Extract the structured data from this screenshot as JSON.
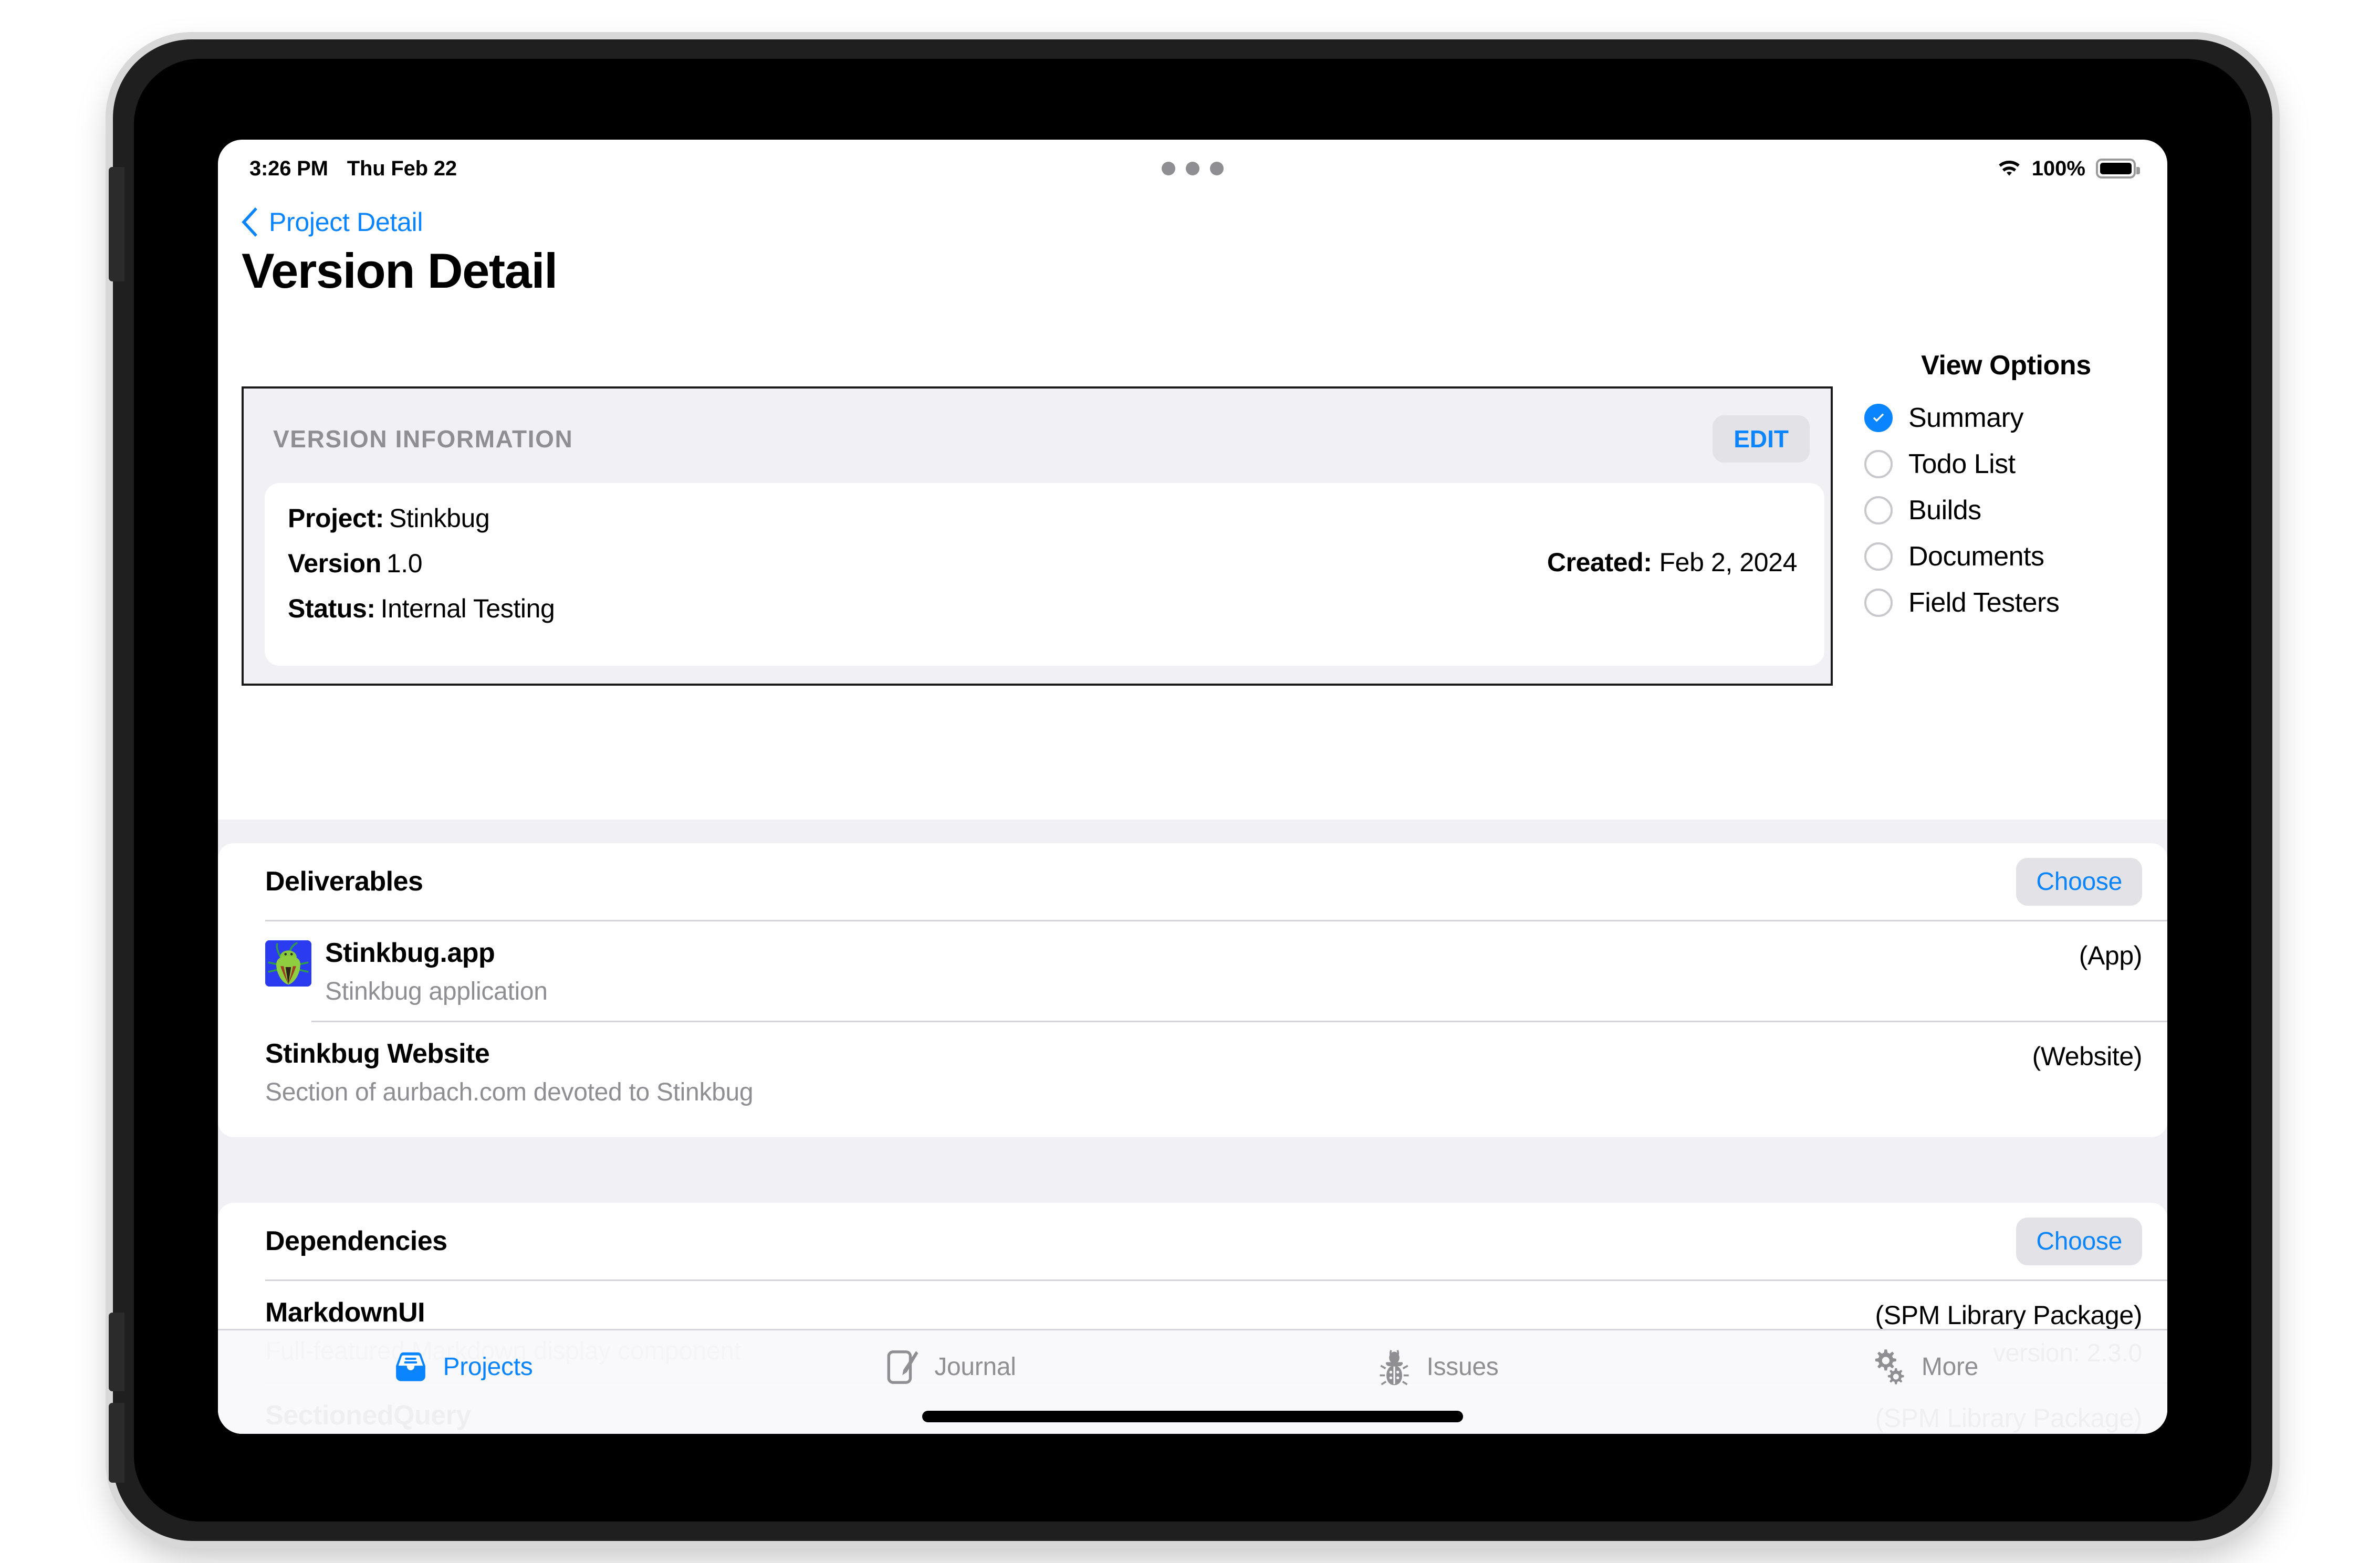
{
  "status_bar": {
    "time": "3:26 PM",
    "date": "Thu Feb 22",
    "battery_percent": "100%",
    "wifi_icon": "wifi-icon",
    "battery_icon": "battery-icon",
    "multitask_dots": "multitasking-dots"
  },
  "nav": {
    "back_label": "Project Detail",
    "back_icon": "chevron-left-icon"
  },
  "page": {
    "title": "Version Detail"
  },
  "version_info": {
    "section_title": "VERSION INFORMATION",
    "edit_label": "EDIT",
    "fields": [
      {
        "label": "Project:",
        "value": "Stinkbug"
      },
      {
        "label": "Version",
        "value": "1.0"
      },
      {
        "label": "Status:",
        "value": "Internal Testing"
      }
    ],
    "created_label": "Created:",
    "created_value": "Feb 2, 2024"
  },
  "view_options": {
    "title": "View Options",
    "items": [
      {
        "label": "Summary",
        "selected": true
      },
      {
        "label": "Todo List",
        "selected": false
      },
      {
        "label": "Builds",
        "selected": false
      },
      {
        "label": "Documents",
        "selected": false
      },
      {
        "label": "Field Testers",
        "selected": false
      }
    ]
  },
  "deliverables": {
    "title": "Deliverables",
    "choose_label": "Choose",
    "rows": [
      {
        "name": "Stinkbug.app",
        "subtitle": "Stinkbug application",
        "type": "(App)",
        "version": "",
        "icon": "stinkbug-app-icon"
      },
      {
        "name": "Stinkbug Website",
        "subtitle": "Section of aurbach.com devoted to Stinkbug",
        "type": "(Website)",
        "version": "",
        "icon": ""
      }
    ]
  },
  "dependencies": {
    "title": "Dependencies",
    "choose_label": "Choose",
    "rows": [
      {
        "name": "MarkdownUI",
        "subtitle": "Full-featured Markdown display component",
        "type": "(SPM Library Package)",
        "version": "version:  2.3.0",
        "icon": ""
      },
      {
        "name": "SectionedQuery",
        "subtitle": "",
        "type": "(SPM Library Package)",
        "version": "",
        "icon": ""
      }
    ]
  },
  "tabbar": {
    "tabs": [
      {
        "label": "Projects",
        "icon": "tray-icon",
        "active": true
      },
      {
        "label": "Journal",
        "icon": "notebook-pencil-icon",
        "active": false
      },
      {
        "label": "Issues",
        "icon": "bug-icon",
        "active": false
      },
      {
        "label": "More",
        "icon": "gears-icon",
        "active": false
      }
    ]
  },
  "colors": {
    "accent": "#0a84ff",
    "secondary_text": "#8e8e93",
    "group_bg": "#f0f0f5",
    "card_bg": "#ffffff",
    "button_bg": "#e2e2e7",
    "app_icon_bg": "#2b3cf0",
    "app_icon_body": "#7ec63f"
  }
}
